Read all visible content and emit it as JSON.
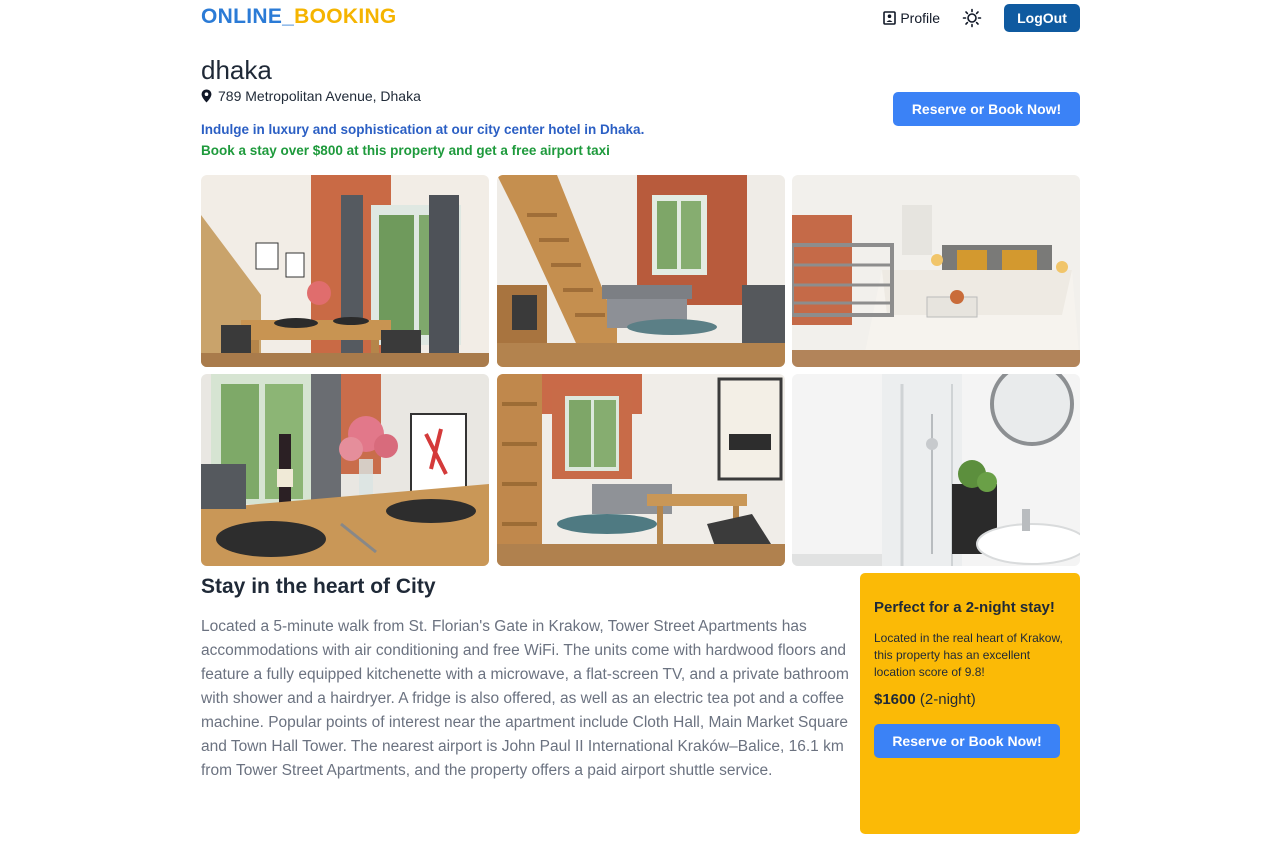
{
  "header": {
    "logo_part1": "ONLINE_",
    "logo_part2": "BOOKING",
    "profile_label": "Profile",
    "logout_label": "LogOut"
  },
  "property": {
    "name": "dhaka",
    "address": "789 Metropolitan Avenue, Dhaka",
    "tagline": "Indulge in luxury and sophistication at our city center hotel in Dhaka.",
    "promo": "Book a stay over $800 at this property and get a free airport taxi",
    "reserve_label": "Reserve or Book Now!"
  },
  "gallery": [
    {
      "subject": "dining room with window"
    },
    {
      "subject": "living room with wooden stairs"
    },
    {
      "subject": "bedroom with bed"
    },
    {
      "subject": "dining table with wine and flowers"
    },
    {
      "subject": "loft living room with poster"
    },
    {
      "subject": "bathroom with shower and sink"
    }
  ],
  "about": {
    "title": "Stay in the heart of City",
    "description": "Located a 5-minute walk from St. Florian's Gate in Krakow, Tower Street Apartments has accommodations with air conditioning and free WiFi. The units come with hardwood floors and feature a fully equipped kitchenette with a microwave, a flat-screen TV, and a private bathroom with shower and a hairdryer. A fridge is also offered, as well as an electric tea pot and a coffee machine. Popular points of interest near the apartment include Cloth Hall, Main Market Square and Town Hall Tower. The nearest airport is John Paul II International Kraków–Balice, 16.1 km from Tower Street Apartments, and the property offers a paid airport shuttle service."
  },
  "card": {
    "title": "Perfect for a 2-night stay!",
    "text": "Located in the real heart of Krakow, this property has an excellent location score of 9.8!",
    "price": "$1600",
    "price_note": "(2-night)",
    "reserve_label": "Reserve or Book Now!"
  },
  "colors": {
    "logo_blue": "#2b7bd6",
    "logo_yellow": "#f5b400",
    "logout_bg": "#0f5aa0",
    "reserve_bg": "#3b82f6",
    "card_bg": "#fbba06",
    "tagline": "#2b5fc4",
    "promo": "#1e9a3c"
  }
}
